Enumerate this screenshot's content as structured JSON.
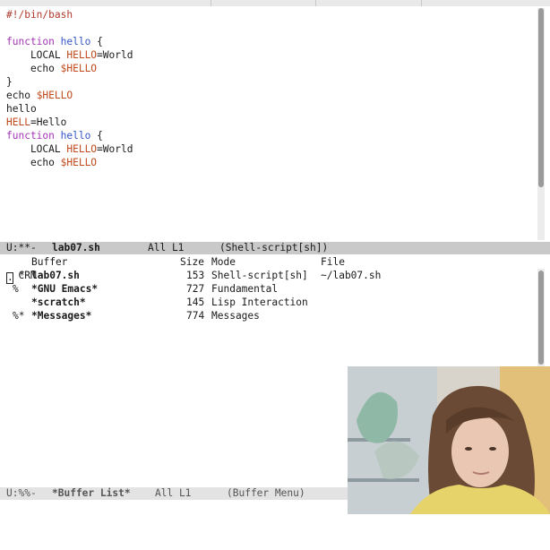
{
  "editor": {
    "code_lines": [
      [
        {
          "t": "#!/bin/bash",
          "c": "cmt"
        }
      ],
      [],
      [
        {
          "t": "function",
          "c": "kw"
        },
        {
          "t": " "
        },
        {
          "t": "hello",
          "c": "fn"
        },
        {
          "t": " {"
        }
      ],
      [
        {
          "t": "    LOCAL "
        },
        {
          "t": "HELLO",
          "c": "var"
        },
        {
          "t": "=World"
        }
      ],
      [
        {
          "t": "    echo "
        },
        {
          "t": "$HELLO",
          "c": "var"
        }
      ],
      [
        {
          "t": "}"
        }
      ],
      [
        {
          "t": "echo "
        },
        {
          "t": "$HELLO",
          "c": "var"
        }
      ],
      [
        {
          "t": "hello"
        }
      ],
      [
        {
          "t": "HELL",
          "c": "var"
        },
        {
          "t": "=Hello"
        }
      ],
      [
        {
          "t": "function",
          "c": "kw"
        },
        {
          "t": " "
        },
        {
          "t": "hello",
          "c": "fn"
        },
        {
          "t": " {"
        }
      ],
      [
        {
          "t": "    LOCAL "
        },
        {
          "t": "HELLO",
          "c": "var"
        },
        {
          "t": "=World"
        }
      ],
      [
        {
          "t": "    echo "
        },
        {
          "t": "$HELLO",
          "c": "var"
        }
      ]
    ],
    "modeline": {
      "status": "U:**-",
      "buffer_name": "lab07.sh",
      "position": "All L1",
      "mode": "(Shell-script[sh])"
    }
  },
  "buffer_list": {
    "header": {
      "crm": "CRM",
      "buffer": "Buffer",
      "size": "Size",
      "mode": "Mode",
      "file": "File"
    },
    "rows": [
      {
        "flags": "*",
        "cursor": ".",
        "name": "lab07.sh",
        "size": "153",
        "mode": "Shell-script[sh]",
        "file": "~/lab07.sh"
      },
      {
        "flags": "%",
        "cursor": "",
        "name": "*GNU Emacs*",
        "size": "727",
        "mode": "Fundamental",
        "file": ""
      },
      {
        "flags": "",
        "cursor": "",
        "name": "*scratch*",
        "size": "145",
        "mode": "Lisp Interaction",
        "file": ""
      },
      {
        "flags": "%*",
        "cursor": "",
        "name": "*Messages*",
        "size": "774",
        "mode": "Messages",
        "file": ""
      }
    ],
    "modeline": {
      "status": "U:%%-",
      "buffer_name": "*Buffer List*",
      "position": "All L1",
      "mode": "(Buffer Menu)"
    }
  },
  "colors": {
    "keyword": "#a335b5",
    "function_name": "#3355cc",
    "variable": "#c04a1c",
    "comment": "#b03a2e",
    "active_modeline": "#c9c9c9",
    "inactive_modeline": "#e3e3e3"
  }
}
